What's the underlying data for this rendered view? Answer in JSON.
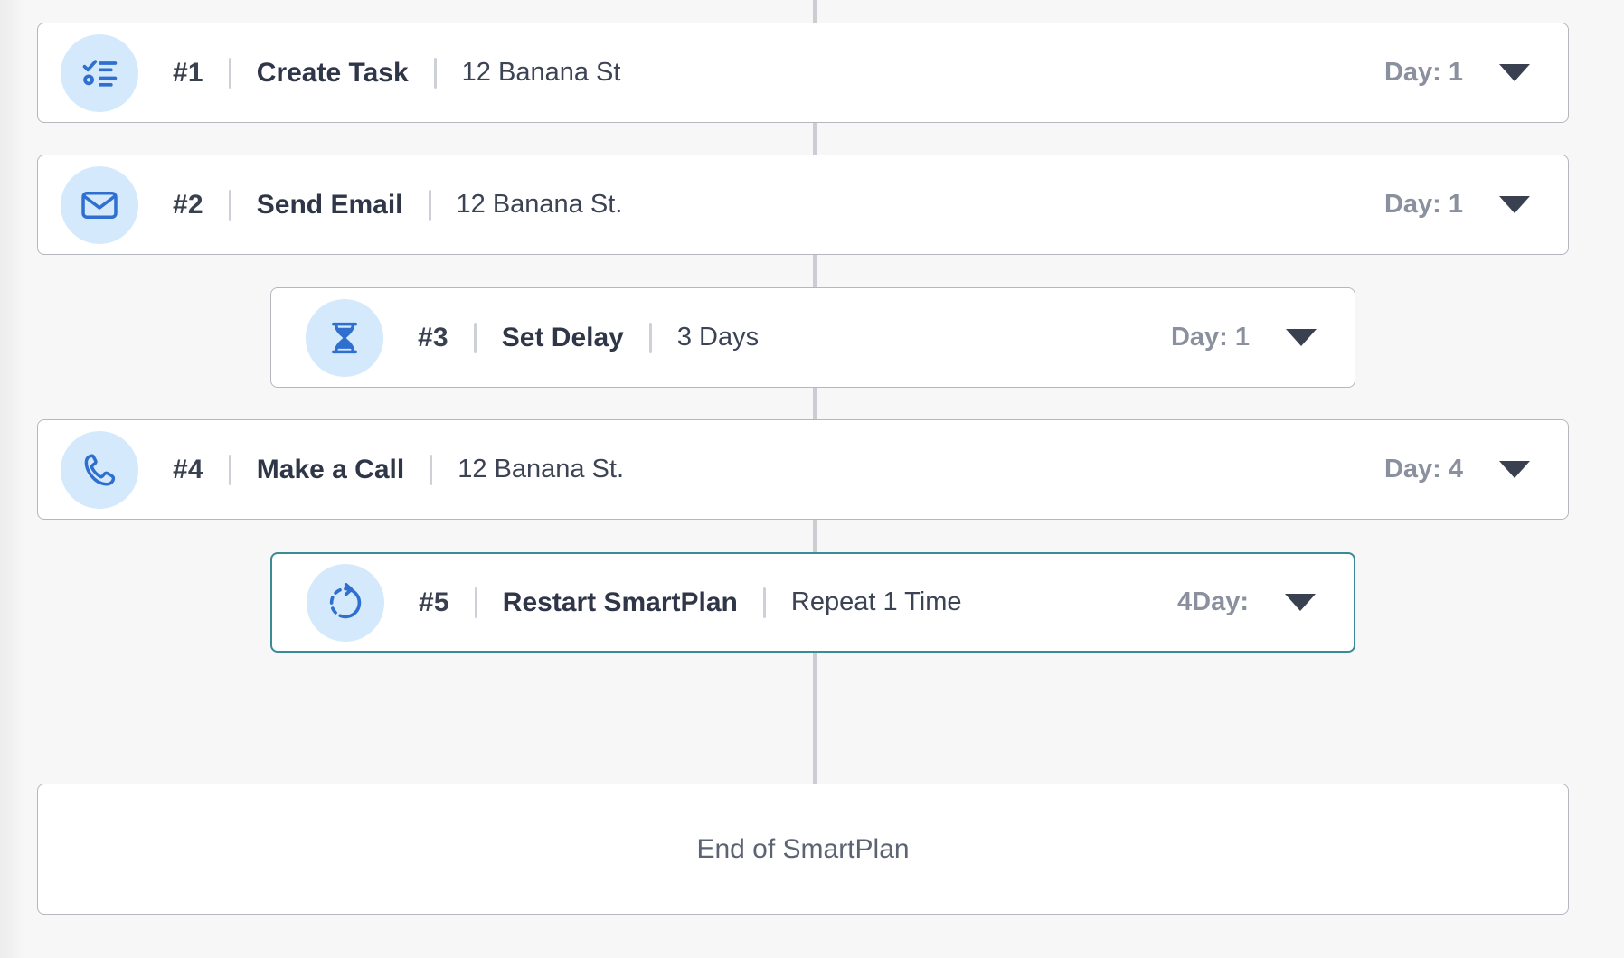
{
  "theme": {
    "page_background": "#F7F7F8",
    "card_background": "#FFFFFF",
    "card_border": "#B4B7BE",
    "connector_line": "#CBCDD4",
    "icon_circle_fill": "#D4E9FB",
    "icon_stroke": "#2F6FD0",
    "selected_border": "#3B8A96",
    "title_color": "#2F3648",
    "muted_color": "#8A909D",
    "caret_color": "#39404F"
  },
  "steps": [
    {
      "number": "#1",
      "title": "Create Task",
      "detail": "12 Banana St",
      "day": "Day: 1",
      "icon": "checklist-icon",
      "selected": false,
      "indented": false
    },
    {
      "number": "#2",
      "title": "Send Email",
      "detail": "12 Banana St.",
      "day": "Day: 1",
      "icon": "envelope-icon",
      "selected": false,
      "indented": false
    },
    {
      "number": "#3",
      "title": "Set Delay",
      "detail": "3 Days",
      "day": "Day: 1",
      "icon": "hourglass-icon",
      "selected": false,
      "indented": true
    },
    {
      "number": "#4",
      "title": "Make a Call",
      "detail": "12 Banana St.",
      "day": "Day: 4",
      "icon": "phone-icon",
      "selected": false,
      "indented": false
    },
    {
      "number": "#5",
      "title": "Restart SmartPlan",
      "detail": "Repeat 1 Time",
      "day": "4Day:",
      "icon": "restart-icon",
      "selected": true,
      "indented": true
    }
  ],
  "footer": {
    "label": "End of SmartPlan"
  }
}
